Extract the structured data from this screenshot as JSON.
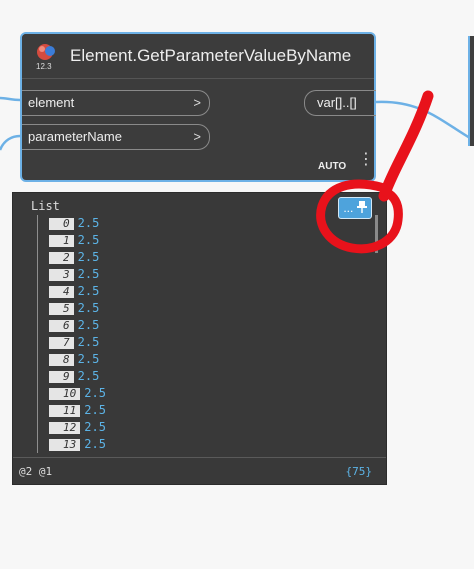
{
  "node": {
    "version": "12.3",
    "title": "Element.GetParameterValueByName",
    "inputs": [
      {
        "label": "element",
        "arrow": ">"
      },
      {
        "label": "parameterName",
        "arrow": ">"
      }
    ],
    "output": {
      "label": "var[]..[]"
    },
    "lacing": "AUTO",
    "menu_glyph": "⋮"
  },
  "preview": {
    "list_title": "List",
    "pin_dots": "...",
    "pin_glyph": "📌",
    "rows": [
      {
        "index": "0",
        "value": "2.5"
      },
      {
        "index": "1",
        "value": "2.5"
      },
      {
        "index": "2",
        "value": "2.5"
      },
      {
        "index": "3",
        "value": "2.5"
      },
      {
        "index": "4",
        "value": "2.5"
      },
      {
        "index": "5",
        "value": "2.5"
      },
      {
        "index": "6",
        "value": "2.5"
      },
      {
        "index": "7",
        "value": "2.5"
      },
      {
        "index": "8",
        "value": "2.5"
      },
      {
        "index": "9",
        "value": "2.5"
      },
      {
        "index": "10",
        "value": "2.5"
      },
      {
        "index": "11",
        "value": "2.5"
      },
      {
        "index": "12",
        "value": "2.5"
      },
      {
        "index": "13",
        "value": "2.5"
      }
    ],
    "levels": "@2 @1",
    "count": "{75}"
  },
  "colors": {
    "wire": "#6db1e6",
    "node_bg": "#3c3c3c",
    "value_text": "#5cb3e6",
    "annotation": "#e8121b"
  }
}
